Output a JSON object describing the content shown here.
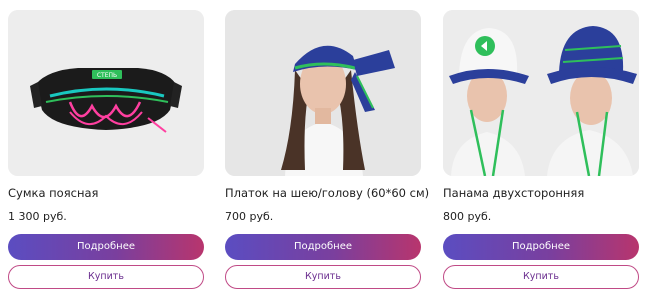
{
  "products": [
    {
      "name": "Сумка поясная",
      "price": "1 300 руб.",
      "more_label": "Подробнее",
      "buy_label": "Купить",
      "image_label": "СТЕПЬ"
    },
    {
      "name": "Платок на шею/голову (60*60 см)",
      "price": "700 руб.",
      "more_label": "Подробнее",
      "buy_label": "Купить"
    },
    {
      "name": "Панама двухсторонняя",
      "price": "800 руб.",
      "more_label": "Подробнее",
      "buy_label": "Купить"
    }
  ],
  "colors": {
    "brand_green": "#2fbf5b",
    "gradient_start": "#5b4dc1",
    "gradient_end": "#b8356d"
  }
}
